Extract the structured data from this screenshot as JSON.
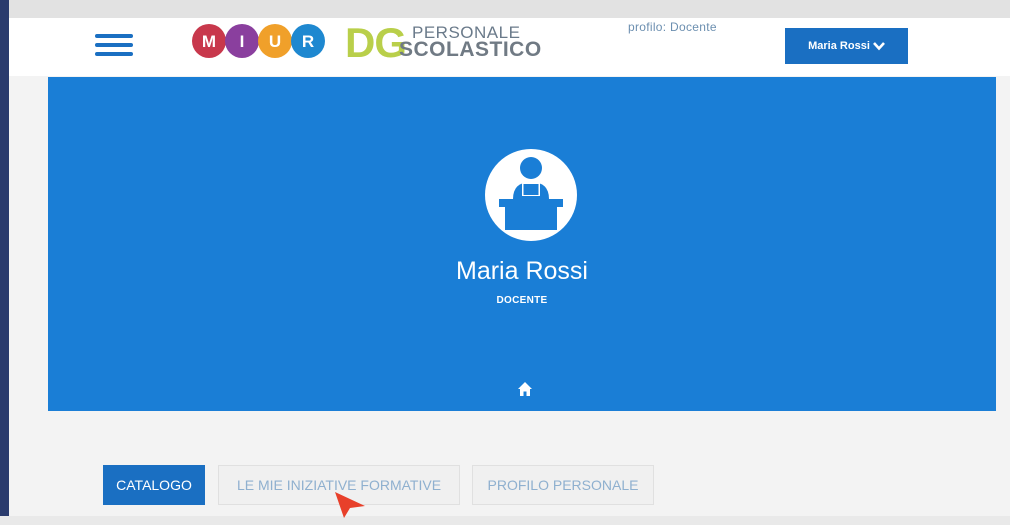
{
  "header": {
    "miur_letters": [
      "M",
      "I",
      "U",
      "R"
    ],
    "dg_letters": "DG",
    "dg_line1": "PERSONALE",
    "dg_line2": "SCOLASTICO",
    "profile_role": "profilo: Docente",
    "user_button_label": "Maria Rossi"
  },
  "hero": {
    "name": "Maria Rossi",
    "role": "DOCENTE"
  },
  "tabs": [
    {
      "label": "CATALOGO",
      "active": true
    },
    {
      "label": "LE MIE INIZIATIVE FORMATIVE",
      "active": false
    },
    {
      "label": "PROFILO PERSONALE",
      "active": false
    }
  ],
  "colors": {
    "primary": "#1a6fc2",
    "hero_bg": "#1a7ed6",
    "dg_green": "#b9cf4a",
    "miur_red": "#c8384c",
    "miur_purple": "#8a3f9e",
    "miur_orange": "#f0a02a",
    "miur_blue": "#1e88d0"
  },
  "icons": [
    "hamburger-icon",
    "chevron-down-icon",
    "teacher-avatar-icon",
    "home-icon",
    "mouse-cursor-icon"
  ]
}
